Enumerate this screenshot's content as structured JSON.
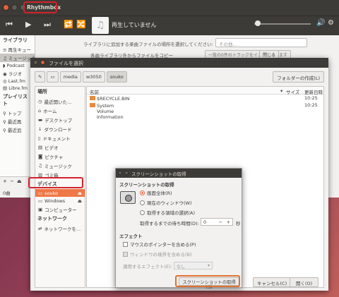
{
  "rhythmbox": {
    "title": "Rhythmbox",
    "now_playing": "再生していません",
    "sidebar_library": "ライブラリ",
    "sidebar_items": [
      "再生キュー",
      "ミュージック",
      "Podcast",
      "ラジオ",
      "Last.fm",
      "Libre.fm"
    ],
    "sidebar_playlist": "プレイリスト",
    "playlist_items": [
      "トップ",
      "最近再",
      "最近追"
    ],
    "import_label": "ライブラリに追加する楽曲ファイルの場所を選択してください:",
    "import_combo": "その他...",
    "copy_label": "各曲ライブラリ外からファイルをコピー",
    "import_button": "一覧の0件のトラックをインポートします",
    "close_button": "閉じる",
    "song_count": "0曲"
  },
  "file_chooser": {
    "title": "ファイルを選択",
    "path": [
      "media",
      "w3050",
      "souko"
    ],
    "new_folder": "フォルダーの作成(L)",
    "places_header": "場所",
    "places": [
      "最近開いた...",
      "ホーム",
      "デスクトップ",
      "ダウンロード",
      "ドキュメント",
      "ビデオ",
      "ピクチャ",
      "ミュージック",
      "ゴミ箱"
    ],
    "devices_header": "デバイス",
    "devices": [
      "souko",
      "Windows",
      "コンピューター"
    ],
    "network_header": "ネットワーク",
    "network": [
      "ネットワークを..."
    ],
    "col_name": "名前",
    "col_size": "サイズ",
    "col_modified": "更新日時",
    "files": [
      {
        "name": "$RECYCLE.BIN",
        "modified": "10:25"
      },
      {
        "name": "System Volume Information",
        "modified": "10:25"
      }
    ],
    "cancel": "キャンセル(C)",
    "open": "開く(O)"
  },
  "screenshot": {
    "title": "スクリーンショットの取得",
    "section_take": "スクリーンショットの取得",
    "options": [
      "画面全体(R)",
      "現在のウィンドウ(W)",
      "取得する領域の選択(A)"
    ],
    "delay_label": "取得するまでの待ち時間(D):",
    "delay_value": "0",
    "delay_unit": "秒",
    "section_effect": "エフェクト",
    "pointer": "マウスのポインターを含める(P)",
    "border": "ウィンドウの境界を含める(B)",
    "apply_effect": "適用するエフェクト(E):",
    "effect_value": "なし",
    "take_button": "スクリーンショットの取得(S)"
  }
}
